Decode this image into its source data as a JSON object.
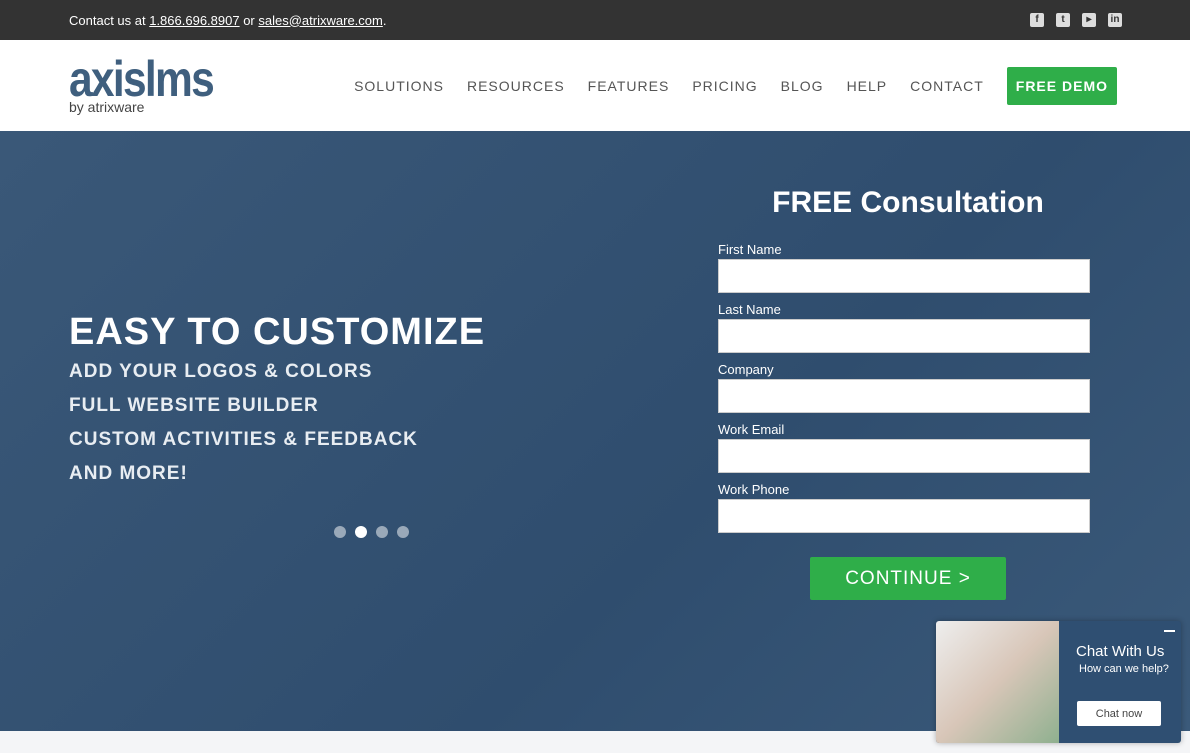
{
  "topbar": {
    "prefix": "Contact us at ",
    "phone": "1.866.696.8907",
    "mid": " or ",
    "email": "sales@atrixware.com",
    "suffix": ".",
    "social": [
      "facebook-icon",
      "twitter-icon",
      "youtube-icon",
      "linkedin-icon"
    ]
  },
  "logo": {
    "main": "axislms",
    "sub": "by atrixware"
  },
  "nav": [
    "SOLUTIONS",
    "RESOURCES",
    "FEATURES",
    "PRICING",
    "BLOG",
    "HELP",
    "CONTACT"
  ],
  "demo": "FREE DEMO",
  "hero": {
    "title": "EASY TO CUSTOMIZE",
    "lines": [
      "ADD YOUR LOGOS & COLORS",
      "FULL WEBSITE BUILDER",
      "CUSTOM ACTIVITIES & FEEDBACK",
      "AND MORE!"
    ],
    "active_slide": 2,
    "slides": 4
  },
  "form": {
    "title": "FREE Consultation",
    "fields": [
      "First Name",
      "Last Name",
      "Company",
      "Work Email",
      "Work Phone"
    ],
    "submit": "CONTINUE >"
  },
  "chat": {
    "title": "Chat With Us",
    "subtitle": "How can we help?",
    "button": "Chat now"
  },
  "colors": {
    "accent": "#2fae49",
    "hero": "#2f4d6e",
    "topbar": "#333333"
  }
}
